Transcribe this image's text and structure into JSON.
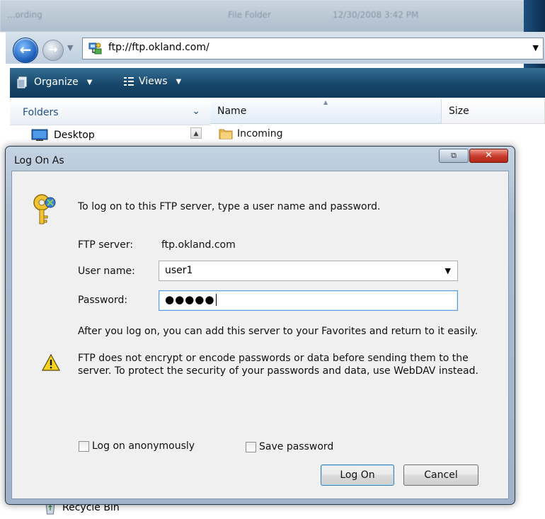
{
  "explorer": {
    "ghost": {
      "left": "...ording",
      "middle": "File Folder",
      "right": "12/30/2008 3:42 PM"
    },
    "address": "ftp://ftp.okland.com/",
    "toolbar": {
      "organize": "Organize",
      "views": "Views"
    },
    "folders_label": "Folders",
    "tree": {
      "desktop": "Desktop",
      "recycle_bin": "Recycle Bin"
    },
    "columns": {
      "name": "Name",
      "size": "Size"
    },
    "files": [
      {
        "name": "Incoming"
      }
    ]
  },
  "dialog": {
    "title": "Log On As",
    "intro": "To log on to this FTP server, type a user name and password.",
    "ftp_server_label": "FTP server:",
    "ftp_server_value": "ftp.okland.com",
    "user_name_label": "User name:",
    "user_name_value": "user1",
    "password_label": "Password:",
    "password_value": "●●●●●",
    "after_logon_text": "After you log on, you can add this server to your Favorites and return to it easily.",
    "warning_line1": "FTP does not encrypt or encode passwords or data before sending them to the",
    "warning_line2": "server.  To protect the security of your passwords and data, use WebDAV instead.",
    "anonymous_label": "Log on anonymously",
    "save_password_label": "Save password",
    "logon_button": "Log On",
    "cancel_button": "Cancel",
    "anonymous_checked": false,
    "save_password_checked": false
  },
  "colors": {
    "toolbar": "#17476b",
    "close_button": "#c8392a",
    "default_button_border": "#3c7fb1",
    "folder_icon": "#e8b84a"
  },
  "icons": [
    "back-arrow-icon",
    "forward-arrow-icon",
    "ftp-network-icon",
    "organize-icon",
    "views-icon",
    "desktop-icon",
    "folder-icon",
    "recycle-bin-icon",
    "keys-icon",
    "warning-icon",
    "restore-icon",
    "close-icon"
  ]
}
